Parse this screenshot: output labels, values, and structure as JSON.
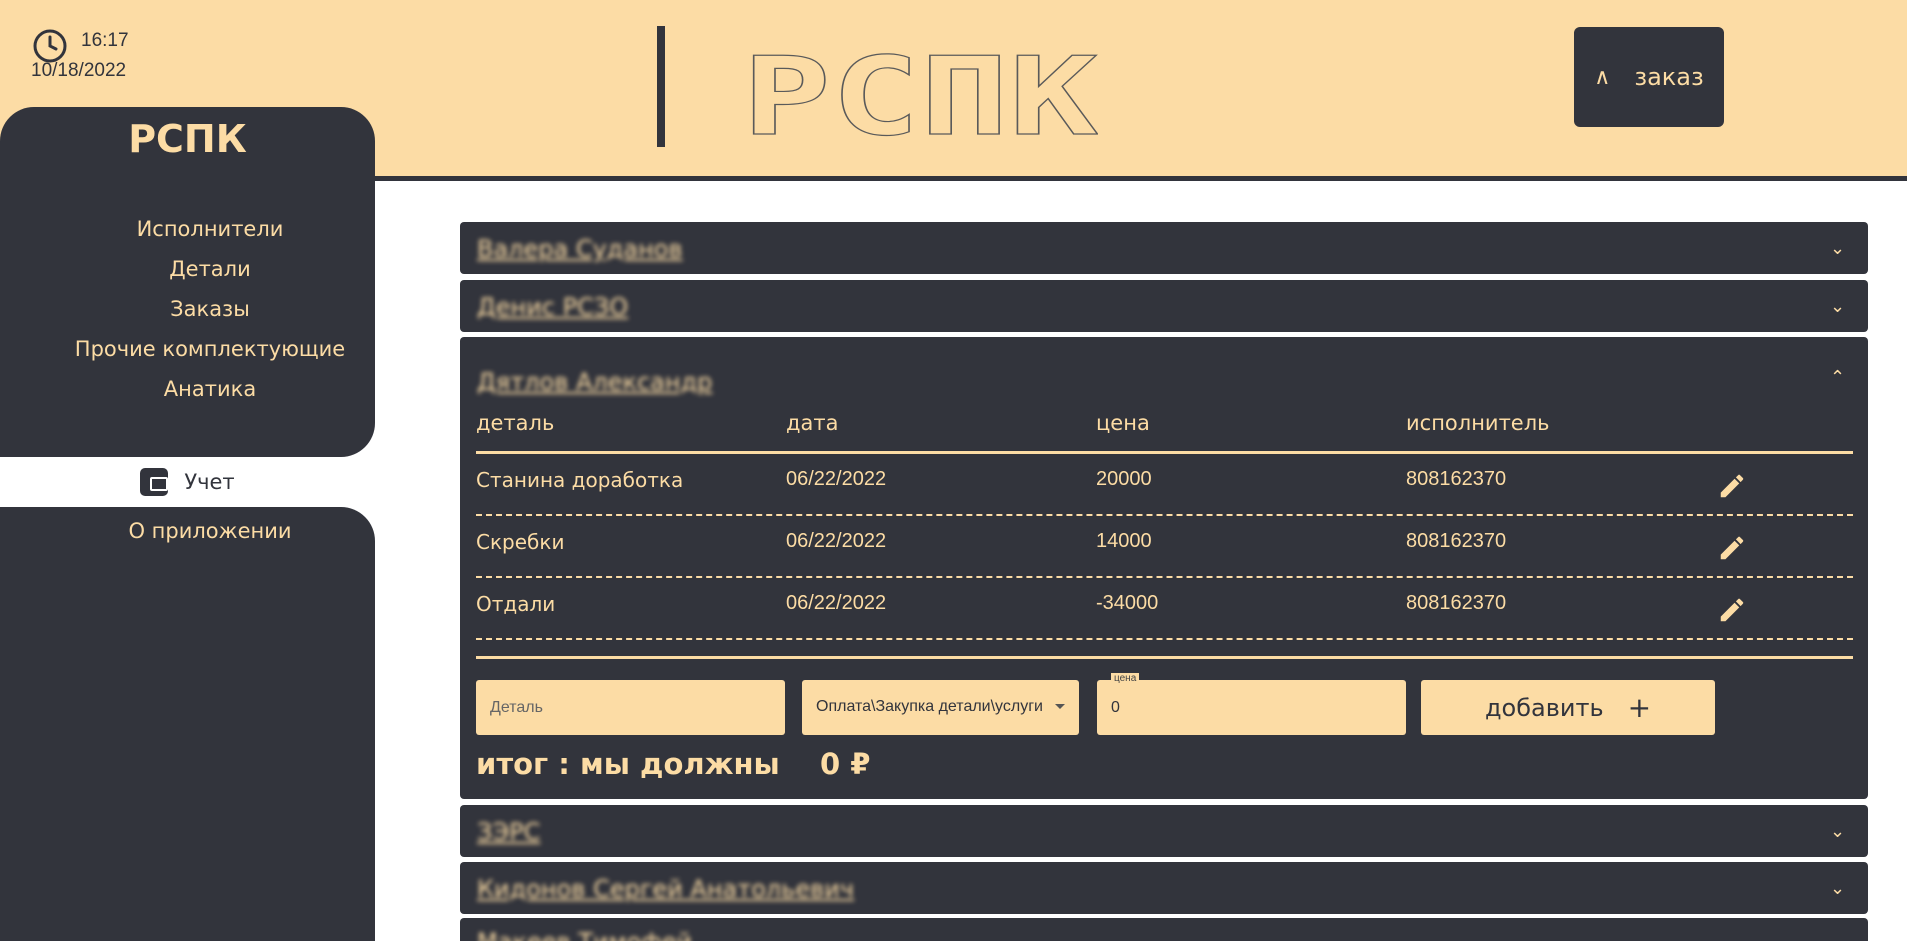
{
  "header": {
    "time": "16:17",
    "date": "10/18/2022",
    "order_button_label": "заказ",
    "order_button_icon": "compass-icon",
    "logo_text": "РСПК"
  },
  "sidebar": {
    "brand": "РСПК",
    "items": [
      {
        "label": "Исполнители"
      },
      {
        "label": "Детали"
      },
      {
        "label": "Заказы"
      },
      {
        "label": "Прочие комплектующие"
      },
      {
        "label": "Анатика"
      },
      {
        "label": "Учет",
        "active": true,
        "icon": "wallet-icon"
      },
      {
        "label": "О приложении"
      }
    ]
  },
  "panels": [
    {
      "title": "Валера Суданов",
      "expanded": false,
      "blurred": true
    },
    {
      "title": "Денис РСЗО",
      "expanded": false,
      "blurred": true
    },
    {
      "title": "Дятлов Александр",
      "expanded": true,
      "blurred": true
    },
    {
      "title": "ЗЭРС",
      "expanded": false,
      "blurred": true
    },
    {
      "title": "Кидонов Сергей Анатольевич",
      "expanded": false,
      "blurred": true
    },
    {
      "title": "Макеев Тимофей",
      "expanded": false,
      "blurred": true
    }
  ],
  "table": {
    "columns": [
      "деталь",
      "дата",
      "цена",
      "исполнитель"
    ],
    "rows": [
      {
        "detail": "Станина доработка",
        "date": "06/22/2022",
        "price": "20000",
        "executor": "808162370"
      },
      {
        "detail": "Скребки",
        "date": "06/22/2022",
        "price": "14000",
        "executor": "808162370"
      },
      {
        "detail": "Отдали",
        "date": "06/22/2022",
        "price": "-34000",
        "executor": "808162370"
      }
    ]
  },
  "form": {
    "detail_placeholder": "Деталь",
    "type_value": "Оплата\\Закупка детали\\услуги",
    "price_label": "цена",
    "price_value": "0",
    "add_label": "добавить",
    "add_icon": "+"
  },
  "summary": {
    "label": "итог : мы должны",
    "value": "0 ₽"
  },
  "colors": {
    "dark": "#32343c",
    "accent": "#fcdca5",
    "white": "#ffffff"
  }
}
